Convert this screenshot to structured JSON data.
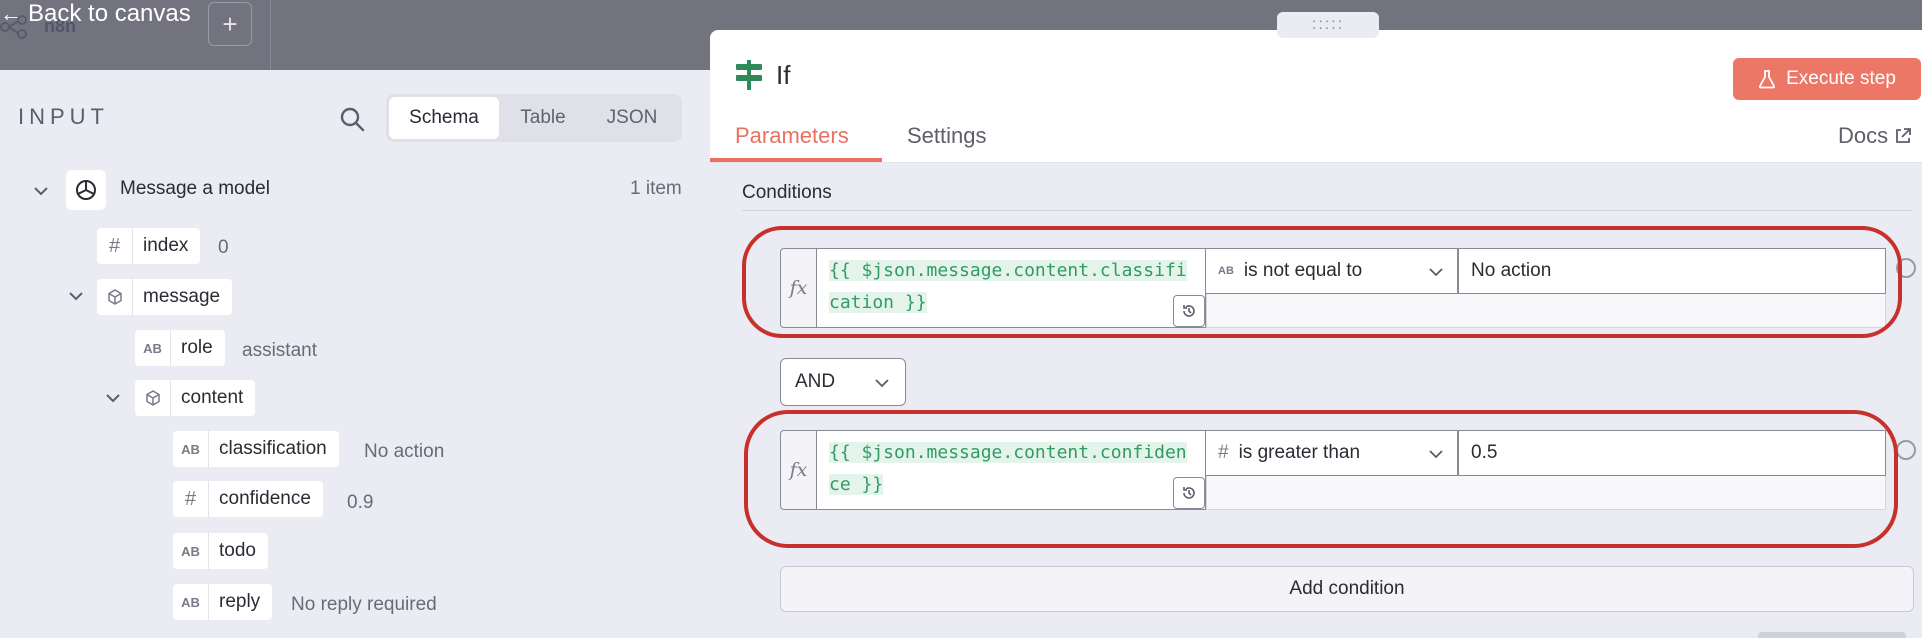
{
  "header": {
    "back_label": "Back to canvas",
    "app_name": "n8n",
    "add_tab_label": "+"
  },
  "input_panel": {
    "title": "INPUT",
    "view_tabs": [
      "Schema",
      "Table",
      "JSON"
    ],
    "active_view": "Schema",
    "source_node": "Message a model",
    "item_count": "1 item",
    "fields": {
      "index": {
        "label": "index",
        "value": "0"
      },
      "message": {
        "label": "message"
      },
      "role": {
        "label": "role",
        "value": "assistant"
      },
      "content": {
        "label": "content"
      },
      "classification": {
        "label": "classification",
        "value": "No action"
      },
      "confidence": {
        "label": "confidence",
        "value": "0.9"
      },
      "todo": {
        "label": "todo"
      },
      "reply": {
        "label": "reply",
        "value": "No reply required"
      }
    },
    "type_badges": {
      "string": "AB",
      "number": "#"
    }
  },
  "node_panel": {
    "drag_handle": ":::::",
    "node_title": "If",
    "execute_label": "Execute step",
    "tabs": {
      "parameters": "Parameters",
      "settings": "Settings",
      "docs": "Docs"
    },
    "conditions_label": "Conditions",
    "combinator": "AND",
    "add_condition_label": "Add condition",
    "conditions": [
      {
        "fx": "fx",
        "expression": "{{ $json.message.content.classification }}",
        "type_badge": "AB",
        "operator": "is not equal to",
        "value": "No action"
      },
      {
        "fx": "fx",
        "expression": "{{ $json.message.content.confidence }}",
        "type_badge": "#",
        "operator": "is greater than",
        "value": "0.5"
      }
    ]
  },
  "colors": {
    "accent": "#e8715f",
    "execute_button": "#ec7766",
    "highlight_ring": "#c8302c",
    "expression_text": "#2f9c63",
    "node_icon": "#2e8b57"
  }
}
